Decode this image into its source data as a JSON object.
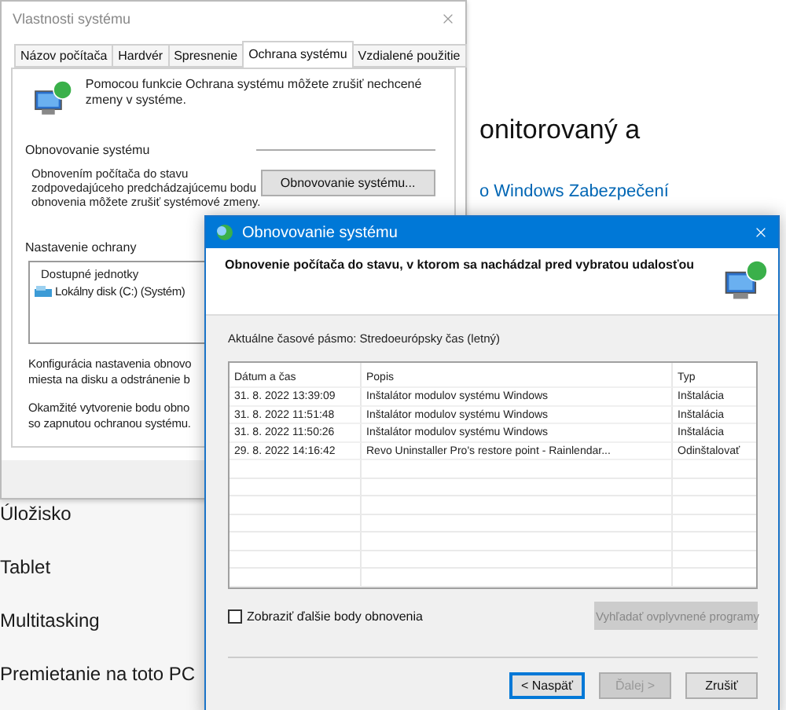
{
  "settings_page": {
    "sidebar_items": [
      "Úložisko",
      "Tablet",
      "Multitasking",
      "Premietanie na toto PC"
    ],
    "text_fragment": "onitorovaný a",
    "link": "o Windows Zabezpečení"
  },
  "system_properties": {
    "title": "Vlastnosti systému",
    "tabs": [
      {
        "label": "Názov počítača",
        "selected": false
      },
      {
        "label": "Hardvér",
        "selected": false
      },
      {
        "label": "Spresnenie",
        "selected": false
      },
      {
        "label": "Ochrana systému",
        "selected": true
      },
      {
        "label": "Vzdialené použitie",
        "selected": false
      }
    ],
    "intro": "Pomocou funkcie Ochrana systému môžete zrušiť nechcené zmeny v systéme.",
    "restore_group": {
      "heading": "Obnovovanie systému",
      "description": [
        "Obnovením počítača do stavu",
        "zodpovedajúceho predchádzajúcemu bodu",
        "obnovenia môžete zrušiť systémové zmeny."
      ],
      "button": "Obnovovanie systému..."
    },
    "protection_group": {
      "heading": "Nastavenie ochrany",
      "list_header": "Dostupné jednotky",
      "drives": [
        "Lokálny disk (C:) (Systém)"
      ],
      "config_text": [
        "Konfigurácia nastavenia obnovo",
        "miesta na disku a odstránenie b"
      ],
      "create_text": [
        "Okamžité vytvorenie bodu obno",
        "so zapnutou ochranou systému."
      ]
    }
  },
  "restore_dialog": {
    "title": "Obnovovanie systému",
    "header": "Obnovenie počítača do stavu, v ktorom sa nachádzal pred vybratou udalosťou",
    "timezone": "Aktuálne časové pásmo: Stredoeurópsky čas (letný)",
    "columns": [
      "Dátum a čas",
      "Popis",
      "Typ"
    ],
    "rows": [
      [
        "31. 8. 2022 13:39:09",
        "Inštalátor modulov systému Windows",
        "Inštalácia"
      ],
      [
        "31. 8. 2022 11:51:48",
        "Inštalátor modulov systému Windows",
        "Inštalácia"
      ],
      [
        "31. 8. 2022 11:50:26",
        "Inštalátor modulov systému Windows",
        "Inštalácia"
      ],
      [
        "29. 8. 2022 14:16:42",
        "Revo Uninstaller Pro's restore point - Rainlendar...",
        "Odinštalovať"
      ]
    ],
    "show_more": {
      "label": "Zobraziť ďalšie body obnovenia",
      "checked": false
    },
    "scan_button": {
      "label": "Vyhľadať ovplyvnené programy",
      "disabled": true
    },
    "buttons": [
      {
        "label": "< Naspäť",
        "disabled": false,
        "default": true
      },
      {
        "label": "Ďalej >",
        "disabled": true,
        "default": false
      },
      {
        "label": "Zrušiť",
        "disabled": false,
        "default": false
      }
    ]
  }
}
